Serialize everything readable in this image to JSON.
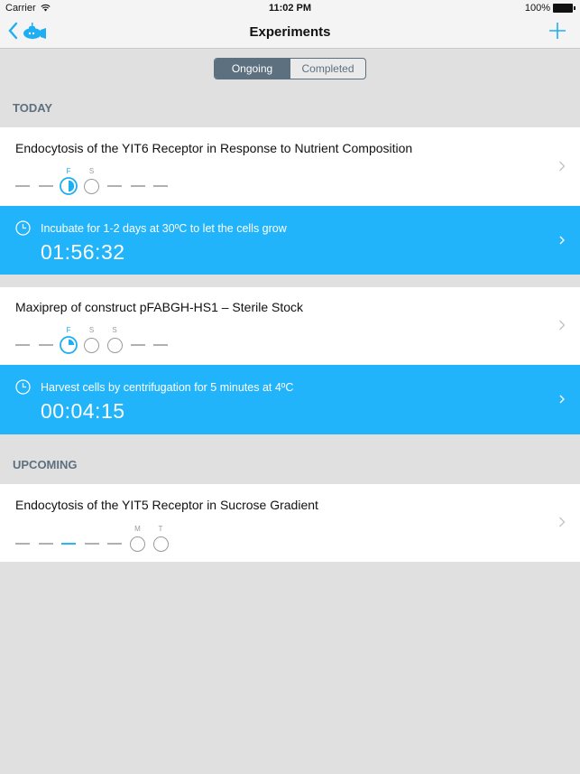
{
  "status_bar": {
    "carrier": "Carrier",
    "time": "11:02 PM",
    "battery": "100%"
  },
  "nav": {
    "title": "Experiments",
    "back_icon": "chevron-left-icon",
    "logo_icon": "submarine-icon",
    "add_icon": "plus-icon"
  },
  "segments": {
    "items": [
      {
        "label": "Ongoing",
        "active": true
      },
      {
        "label": "Completed",
        "active": false
      }
    ]
  },
  "sections": {
    "today": "TODAY",
    "upcoming": "UPCOMING"
  },
  "experiments": [
    {
      "title": "Endocytosis of the YIT6 Receptor in Response to Nutrient Composition",
      "days": [
        {
          "type": "dash"
        },
        {
          "type": "dash"
        },
        {
          "type": "circle",
          "label": "F",
          "active": true,
          "progress": 0.5
        },
        {
          "type": "circle",
          "label": "S"
        },
        {
          "type": "dash"
        },
        {
          "type": "dash"
        },
        {
          "type": "dash"
        }
      ],
      "timer": {
        "step": "Incubate for 1-2 days at 30ºC to let the cells grow",
        "countdown": "01:56:32"
      }
    },
    {
      "title": "Maxiprep of construct pFABGH-HS1 – Sterile Stock",
      "days": [
        {
          "type": "dash"
        },
        {
          "type": "dash"
        },
        {
          "type": "circle",
          "label": "F",
          "active": true,
          "progress": 0.25
        },
        {
          "type": "circle",
          "label": "S"
        },
        {
          "type": "circle",
          "label": "S"
        },
        {
          "type": "dash"
        },
        {
          "type": "dash"
        }
      ],
      "timer": {
        "step": "Harvest cells by centrifugation for 5 minutes at 4ºC",
        "countdown": "00:04:15"
      }
    },
    {
      "title": "Endocytosis of the YIT5 Receptor in Sucrose Gradient",
      "days": [
        {
          "type": "dash"
        },
        {
          "type": "dash"
        },
        {
          "type": "dash",
          "active": true
        },
        {
          "type": "dash"
        },
        {
          "type": "dash"
        },
        {
          "type": "circle",
          "label": "M"
        },
        {
          "type": "circle",
          "label": "T"
        }
      ]
    }
  ],
  "colors": {
    "accent": "#21b4fa",
    "segment": "#5d7080",
    "background": "#e0e0e0"
  }
}
